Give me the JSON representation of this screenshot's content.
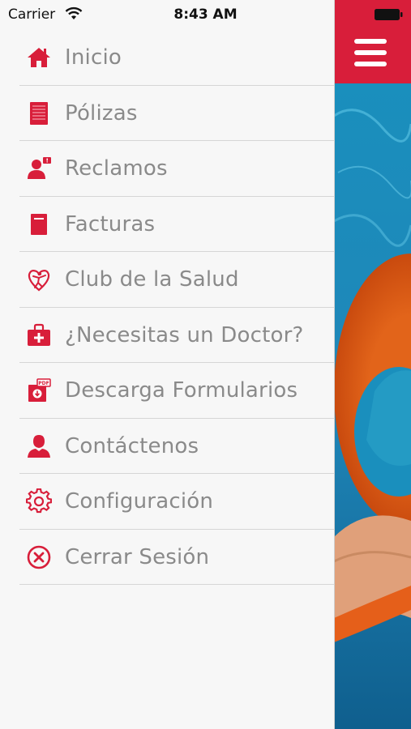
{
  "status_bar": {
    "carrier": "Carrier",
    "time": "8:43 AM"
  },
  "accent_color": "#d81e3a",
  "menu": {
    "items": [
      {
        "label": "Inicio",
        "icon": "home-icon"
      },
      {
        "label": "Pólizas",
        "icon": "policy-book-icon"
      },
      {
        "label": "Reclamos",
        "icon": "claims-person-icon"
      },
      {
        "label": "Facturas",
        "icon": "invoice-icon"
      },
      {
        "label": "Club de la Salud",
        "icon": "health-club-icon"
      },
      {
        "label": "¿Necesitas un Doctor?",
        "icon": "medical-bag-icon"
      },
      {
        "label": "Descarga Formularios",
        "icon": "pdf-download-icon"
      },
      {
        "label": "Contáctenos",
        "icon": "contact-person-icon"
      },
      {
        "label": "Configuración",
        "icon": "gear-icon"
      },
      {
        "label": "Cerrar Sesión",
        "icon": "close-circle-icon"
      }
    ]
  }
}
